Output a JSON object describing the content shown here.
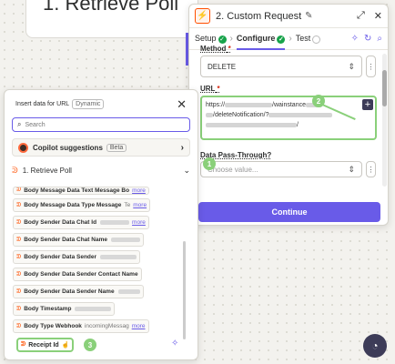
{
  "canvas": {
    "poll_card_title": "1. Retrieve Poll"
  },
  "editor": {
    "title": "2. Custom Request",
    "header_icons": [
      "pencil-icon",
      "expand-icon",
      "close-icon"
    ],
    "steps": [
      {
        "label": "Setup",
        "state": "done"
      },
      {
        "label": "Configure",
        "state": "done"
      },
      {
        "label": "Test",
        "state": "pending"
      }
    ],
    "method_label": "Method",
    "method_value": "DELETE",
    "url_label": "URL",
    "url_line1_prefix": "https://",
    "url_line1_mid": "/wainstance",
    "url_line2": "/deleteNotification/?",
    "url_line3_suffix": "/",
    "passthrough_label": "Data Pass-Through?",
    "passthrough_placeholder": "Choose value...",
    "continue_label": "Continue"
  },
  "insert_panel": {
    "header_text": "Insert data for URL",
    "header_chip": "Dynamic",
    "search_placeholder": "Search",
    "copilot_label": "Copilot suggestions",
    "copilot_chip": "Beta",
    "group_label": "1.  Retrieve Poll",
    "items": [
      {
        "label": "Body Message Data Text Message Bo",
        "more": "more"
      },
      {
        "label": "Body Message Data Type Message",
        "value": "Te",
        "more": "more"
      },
      {
        "label": "Body Sender Data Chat Id",
        "more": "more",
        "blurred": true
      },
      {
        "label": "Body Sender Data Chat Name",
        "blurred": true
      },
      {
        "label": "Body Sender Data Sender",
        "blurred": true
      },
      {
        "label": "Body Sender Data Sender Contact Name"
      },
      {
        "label": "Body Sender Data Sender Name",
        "blurred": true
      },
      {
        "label": "Body Timestamp",
        "blurred": true
      },
      {
        "label": "Body Type Webhook",
        "value": "incomingMessag",
        "more": "more"
      }
    ],
    "receipt_item": "Receipt Id"
  },
  "annotations": {
    "badge1": "1",
    "badge2": "2",
    "badge3": "3"
  },
  "colors": {
    "accent": "#695be8",
    "zapier_orange": "#ff4f00",
    "highlight_green": "#8ad07a"
  }
}
